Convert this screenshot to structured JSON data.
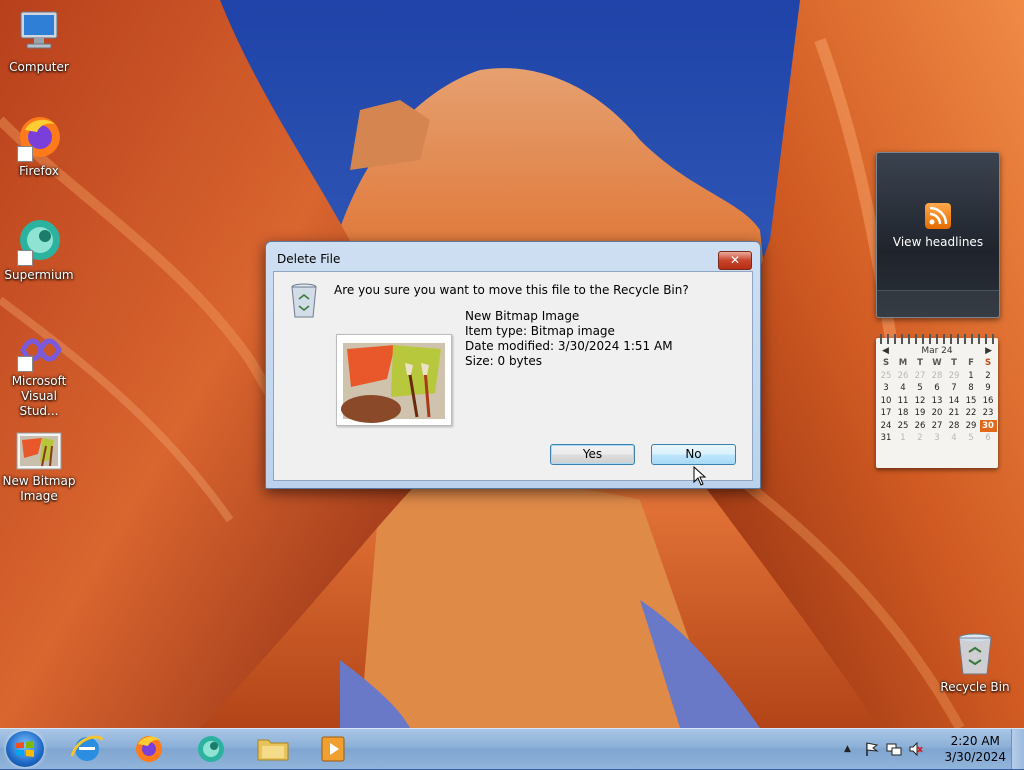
{
  "desktop": {
    "icons": [
      {
        "label": "Computer",
        "icon": "computer-icon"
      },
      {
        "label": "Firefox",
        "icon": "firefox-icon"
      },
      {
        "label": "Supermium",
        "icon": "supermium-icon"
      },
      {
        "label": "Microsoft Visual Stud...",
        "icon": "visual-studio-icon"
      },
      {
        "label": "New Bitmap Image",
        "icon": "bitmap-file-icon"
      },
      {
        "label": "Recycle Bin",
        "icon": "recycle-bin-icon"
      }
    ]
  },
  "gadgets": {
    "feed": {
      "label": "View headlines",
      "icon": "rss-icon"
    },
    "calendar": {
      "month_label": "Mar 24",
      "weekdays": [
        "S",
        "M",
        "T",
        "W",
        "T",
        "F",
        "S"
      ],
      "weeks": [
        [
          "25",
          "26",
          "27",
          "28",
          "29",
          "1",
          "2"
        ],
        [
          "3",
          "4",
          "5",
          "6",
          "7",
          "8",
          "9"
        ],
        [
          "10",
          "11",
          "12",
          "13",
          "14",
          "15",
          "16"
        ],
        [
          "17",
          "18",
          "19",
          "20",
          "21",
          "22",
          "23"
        ],
        [
          "24",
          "25",
          "26",
          "27",
          "28",
          "29",
          "30"
        ],
        [
          "31",
          "1",
          "2",
          "3",
          "4",
          "5",
          "6"
        ]
      ],
      "today": "30"
    }
  },
  "dialog": {
    "title": "Delete File",
    "close_glyph": "✕",
    "question": "Are you sure you want to move this file to the Recycle Bin?",
    "file": {
      "name": "New Bitmap Image",
      "item_type": "Item type: Bitmap image",
      "date_modified": "Date modified: 3/30/2024 1:51 AM",
      "size": "Size: 0 bytes"
    },
    "buttons": {
      "yes": "Yes",
      "no": "No"
    }
  },
  "taskbar": {
    "pinned": [
      "internet-explorer-icon",
      "firefox-icon",
      "supermium-icon",
      "file-explorer-icon",
      "media-player-icon"
    ],
    "tray": {
      "show_hidden": "▲",
      "time": "2:20 AM",
      "date": "3/30/2024"
    }
  },
  "colors": {
    "accent": "#3c7fb1",
    "close_red": "#c8442b",
    "today_orange": "#e06a1a"
  }
}
